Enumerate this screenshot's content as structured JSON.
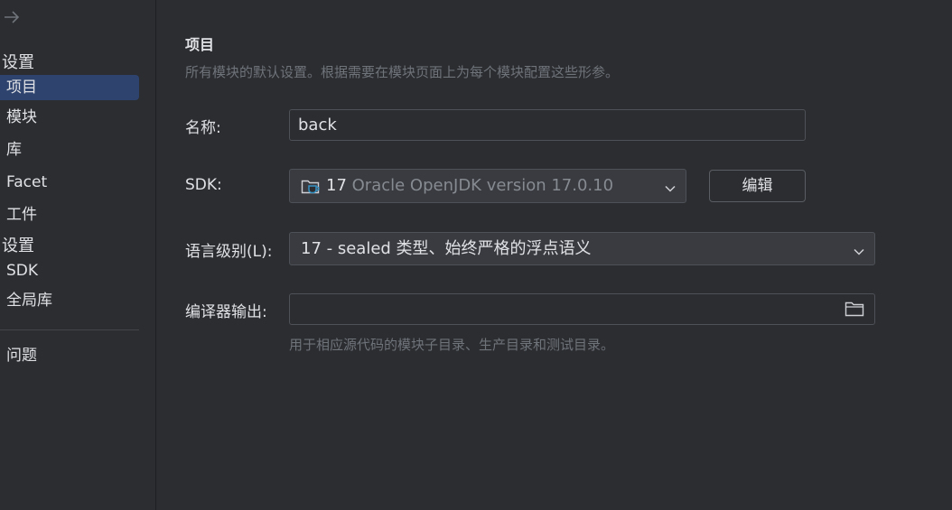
{
  "sidebar": {
    "back_arrow": "arrow-right-icon",
    "section1_title": "设置",
    "items1": [
      {
        "label": "项目",
        "selected": true
      },
      {
        "label": "模块",
        "selected": false
      },
      {
        "label": "库",
        "selected": false
      },
      {
        "label": "Facet",
        "selected": false
      },
      {
        "label": "工件",
        "selected": false
      }
    ],
    "section2_title": "设置",
    "items2": [
      {
        "label": "SDK"
      },
      {
        "label": "全局库"
      }
    ],
    "items3": [
      {
        "label": "问题"
      }
    ]
  },
  "main": {
    "title": "项目",
    "description": "所有模块的默认设置。根据需要在模块页面上为每个模块配置这些形参。",
    "name_label": "名称:",
    "name_value": "back",
    "sdk_label": "SDK:",
    "sdk_version": "17",
    "sdk_description": "Oracle OpenJDK version 17.0.10",
    "sdk_icon": "folder-cup-icon",
    "edit_button": "编辑",
    "language_level_label": "语言级别(L):",
    "language_level_value": "17 - sealed 类型、始终严格的浮点语义",
    "compiler_output_label": "编译器输出:",
    "compiler_output_value": "",
    "compiler_output_hint": "用于相应源代码的模块子目录、生产目录和测试目录。"
  },
  "colors": {
    "background": "#2b2d30",
    "selection": "#2e436e",
    "accent": "#3574f0",
    "muted_text": "#6f737a"
  }
}
